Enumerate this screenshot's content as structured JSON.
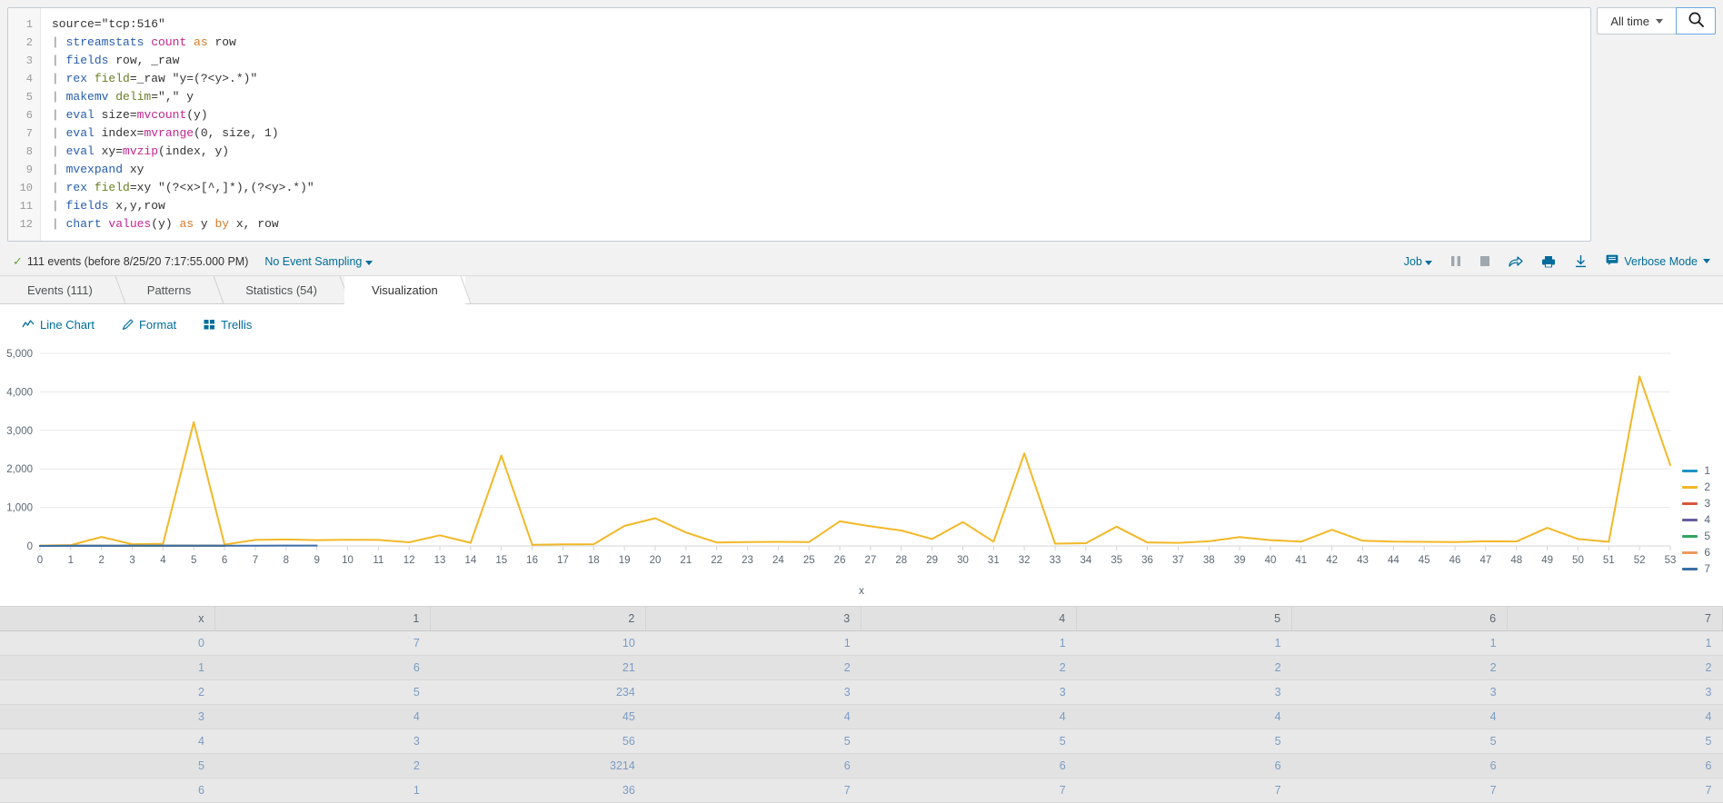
{
  "search": {
    "lines": [
      {
        "n": "1",
        "tokens": [
          {
            "t": "plain",
            "v": "source=\"tcp:516\""
          }
        ]
      },
      {
        "n": "2",
        "tokens": [
          {
            "t": "pipe",
            "v": "| "
          },
          {
            "t": "cmd",
            "v": "streamstats "
          },
          {
            "t": "kw",
            "v": "count "
          },
          {
            "t": "as",
            "v": "as "
          },
          {
            "t": "plain",
            "v": "row"
          }
        ]
      },
      {
        "n": "3",
        "tokens": [
          {
            "t": "pipe",
            "v": "| "
          },
          {
            "t": "cmd",
            "v": "fields "
          },
          {
            "t": "plain",
            "v": "row, _raw"
          }
        ]
      },
      {
        "n": "4",
        "tokens": [
          {
            "t": "pipe",
            "v": "| "
          },
          {
            "t": "cmd",
            "v": "rex "
          },
          {
            "t": "arg",
            "v": "field"
          },
          {
            "t": "plain",
            "v": "=_raw \"y=(?<y>.*)\""
          }
        ]
      },
      {
        "n": "5",
        "tokens": [
          {
            "t": "pipe",
            "v": "| "
          },
          {
            "t": "cmd",
            "v": "makemv "
          },
          {
            "t": "arg",
            "v": "delim"
          },
          {
            "t": "plain",
            "v": "=\",\" y"
          }
        ]
      },
      {
        "n": "6",
        "tokens": [
          {
            "t": "pipe",
            "v": "| "
          },
          {
            "t": "cmd",
            "v": "eval "
          },
          {
            "t": "plain",
            "v": "size="
          },
          {
            "t": "kw",
            "v": "mvcount"
          },
          {
            "t": "plain",
            "v": "(y)"
          }
        ]
      },
      {
        "n": "7",
        "tokens": [
          {
            "t": "pipe",
            "v": "| "
          },
          {
            "t": "cmd",
            "v": "eval "
          },
          {
            "t": "plain",
            "v": "index="
          },
          {
            "t": "kw",
            "v": "mvrange"
          },
          {
            "t": "plain",
            "v": "(0, size, 1)"
          }
        ]
      },
      {
        "n": "8",
        "tokens": [
          {
            "t": "pipe",
            "v": "| "
          },
          {
            "t": "cmd",
            "v": "eval "
          },
          {
            "t": "plain",
            "v": "xy="
          },
          {
            "t": "kw",
            "v": "mvzip"
          },
          {
            "t": "plain",
            "v": "(index, y)"
          }
        ]
      },
      {
        "n": "9",
        "tokens": [
          {
            "t": "pipe",
            "v": "| "
          },
          {
            "t": "cmd",
            "v": "mvexpand "
          },
          {
            "t": "plain",
            "v": "xy"
          }
        ]
      },
      {
        "n": "10",
        "tokens": [
          {
            "t": "pipe",
            "v": "| "
          },
          {
            "t": "cmd",
            "v": "rex "
          },
          {
            "t": "arg",
            "v": "field"
          },
          {
            "t": "plain",
            "v": "=xy \"(?<x>[^,]*),(?<y>.*)\""
          }
        ]
      },
      {
        "n": "11",
        "tokens": [
          {
            "t": "pipe",
            "v": "| "
          },
          {
            "t": "cmd",
            "v": "fields "
          },
          {
            "t": "plain",
            "v": "x,y,row"
          }
        ]
      },
      {
        "n": "12",
        "tokens": [
          {
            "t": "pipe",
            "v": "| "
          },
          {
            "t": "cmd",
            "v": "chart "
          },
          {
            "t": "kw",
            "v": "values"
          },
          {
            "t": "plain",
            "v": "(y) "
          },
          {
            "t": "as",
            "v": "as "
          },
          {
            "t": "plain",
            "v": "y "
          },
          {
            "t": "as",
            "v": "by "
          },
          {
            "t": "plain",
            "v": "x, row"
          }
        ]
      }
    ],
    "time_range_label": "All time",
    "search_icon": "search-icon"
  },
  "status": {
    "check_glyph": "✓",
    "event_count_text": "111 events (before 8/25/20 7:17:55.000 PM)",
    "event_sampling_label": "No Event Sampling",
    "job_label": "Job",
    "mode_label": "Verbose Mode",
    "icons": [
      "pause-icon",
      "stop-icon",
      "share-icon",
      "print-icon",
      "export-icon"
    ]
  },
  "tabs": [
    {
      "label": "Events (111)",
      "active": false
    },
    {
      "label": "Patterns",
      "active": false
    },
    {
      "label": "Statistics (54)",
      "active": false
    },
    {
      "label": "Visualization",
      "active": true
    }
  ],
  "viz_toolbar": [
    {
      "label": "Line Chart",
      "icon": "line-chart-icon"
    },
    {
      "label": "Format",
      "icon": "pencil-icon"
    },
    {
      "label": "Trellis",
      "icon": "grid-icon"
    }
  ],
  "chart_data": {
    "type": "line",
    "title": "",
    "xlabel": "x",
    "ylabel": "",
    "ylim": [
      0,
      5000
    ],
    "xlim": [
      0,
      53
    ],
    "grid": true,
    "legend_position": "right",
    "ytick_labels": [
      "0",
      "1,000",
      "2,000",
      "3,000",
      "4,000",
      "5,000"
    ],
    "ytick_values": [
      0,
      1000,
      2000,
      3000,
      4000,
      5000
    ],
    "x": [
      0,
      1,
      2,
      3,
      4,
      5,
      6,
      7,
      8,
      9,
      10,
      11,
      12,
      13,
      14,
      15,
      16,
      17,
      18,
      19,
      20,
      21,
      22,
      23,
      24,
      25,
      26,
      27,
      28,
      29,
      30,
      31,
      32,
      33,
      34,
      35,
      36,
      37,
      38,
      39,
      40,
      41,
      42,
      43,
      44,
      45,
      46,
      47,
      48,
      49,
      50,
      51,
      52,
      53
    ],
    "xtick_labels": [
      "0",
      "1",
      "2",
      "3",
      "4",
      "5",
      "6",
      "7",
      "8",
      "9",
      "10",
      "11",
      "12",
      "13",
      "14",
      "15",
      "16",
      "17",
      "18",
      "19",
      "20",
      "21",
      "22",
      "23",
      "24",
      "25",
      "26",
      "27",
      "28",
      "29",
      "30",
      "31",
      "32",
      "33",
      "34",
      "35",
      "36",
      "37",
      "38",
      "39",
      "40",
      "41",
      "42",
      "43",
      "44",
      "45",
      "46",
      "47",
      "48",
      "49",
      "50",
      "51",
      "52",
      "53"
    ],
    "series": [
      {
        "name": "1",
        "color": "#1e93c6",
        "values": [
          7,
          6,
          5,
          4,
          3,
          2,
          1,
          null,
          null,
          null,
          null,
          null,
          null,
          null,
          null,
          null,
          null,
          null,
          null,
          null,
          null,
          null,
          null,
          null,
          null,
          null,
          null,
          null,
          null,
          null,
          null,
          null,
          null,
          null,
          null,
          null,
          null,
          null,
          null,
          null,
          null,
          null,
          null,
          null,
          null,
          null,
          null,
          null,
          null,
          null,
          null,
          null,
          null,
          null
        ]
      },
      {
        "name": "2",
        "color": "#f2b827",
        "values": [
          10,
          21,
          234,
          45,
          56,
          3214,
          36,
          156,
          168,
          150,
          160,
          155,
          95,
          275,
          80,
          2350,
          30,
          40,
          45,
          520,
          720,
          350,
          90,
          100,
          105,
          100,
          640,
          510,
          400,
          180,
          620,
          110,
          2400,
          60,
          70,
          500,
          90,
          80,
          120,
          230,
          150,
          110,
          420,
          135,
          110,
          105,
          100,
          120,
          115,
          470,
          180,
          105,
          4400,
          2100
        ]
      },
      {
        "name": "3",
        "color": "#d6563c",
        "values": [
          1,
          2,
          3,
          4,
          5,
          6,
          7,
          null,
          null,
          null,
          null,
          null,
          null,
          null,
          null,
          null,
          null,
          null,
          null,
          null,
          null,
          null,
          null,
          null,
          null,
          null,
          null,
          null,
          null,
          null,
          null,
          null,
          null,
          null,
          null,
          null,
          null,
          null,
          null,
          null,
          null,
          null,
          null,
          null,
          null,
          null,
          null,
          null,
          null,
          null,
          null,
          null,
          null,
          null
        ]
      },
      {
        "name": "4",
        "color": "#6a5c9e",
        "values": [
          1,
          2,
          3,
          4,
          5,
          6,
          7,
          null,
          null,
          null,
          null,
          null,
          null,
          null,
          null,
          null,
          null,
          null,
          null,
          null,
          null,
          null,
          null,
          null,
          null,
          null,
          null,
          null,
          null,
          null,
          null,
          null,
          null,
          null,
          null,
          null,
          null,
          null,
          null,
          null,
          null,
          null,
          null,
          null,
          null,
          null,
          null,
          null,
          null,
          null,
          null,
          null,
          null,
          null
        ]
      },
      {
        "name": "5",
        "color": "#31a35f",
        "values": [
          1,
          2,
          3,
          4,
          5,
          6,
          7,
          null,
          null,
          null,
          null,
          null,
          null,
          null,
          null,
          null,
          null,
          null,
          null,
          null,
          null,
          null,
          null,
          null,
          null,
          null,
          null,
          null,
          null,
          null,
          null,
          null,
          null,
          null,
          null,
          null,
          null,
          null,
          null,
          null,
          null,
          null,
          null,
          null,
          null,
          null,
          null,
          null,
          null,
          null,
          null,
          null,
          null,
          null
        ]
      },
      {
        "name": "6",
        "color": "#ec9960",
        "values": [
          1,
          2,
          3,
          4,
          5,
          6,
          7,
          null,
          null,
          null,
          null,
          null,
          null,
          null,
          null,
          null,
          null,
          null,
          null,
          null,
          null,
          null,
          null,
          null,
          null,
          null,
          null,
          null,
          null,
          null,
          null,
          null,
          null,
          null,
          null,
          null,
          null,
          null,
          null,
          null,
          null,
          null,
          null,
          null,
          null,
          null,
          null,
          null,
          null,
          null,
          null,
          null,
          null,
          null
        ]
      },
      {
        "name": "7",
        "color": "#3b6ea5",
        "values": [
          1,
          2,
          3,
          4,
          5,
          6,
          7,
          8,
          9,
          10,
          null,
          null,
          null,
          null,
          null,
          null,
          null,
          null,
          null,
          null,
          null,
          null,
          null,
          null,
          null,
          null,
          null,
          null,
          null,
          null,
          null,
          null,
          null,
          null,
          null,
          null,
          null,
          null,
          null,
          null,
          null,
          null,
          null,
          null,
          null,
          null,
          null,
          null,
          null,
          null,
          null,
          null,
          null,
          null
        ]
      }
    ]
  },
  "results_table": {
    "headers": [
      "x",
      "1",
      "2",
      "3",
      "4",
      "5",
      "6",
      "7"
    ],
    "rows": [
      [
        "0",
        "7",
        "10",
        "1",
        "1",
        "1",
        "1",
        "1"
      ],
      [
        "1",
        "6",
        "21",
        "2",
        "2",
        "2",
        "2",
        "2"
      ],
      [
        "2",
        "5",
        "234",
        "3",
        "3",
        "3",
        "3",
        "3"
      ],
      [
        "3",
        "4",
        "45",
        "4",
        "4",
        "4",
        "4",
        "4"
      ],
      [
        "4",
        "3",
        "56",
        "5",
        "5",
        "5",
        "5",
        "5"
      ],
      [
        "5",
        "2",
        "3214",
        "6",
        "6",
        "6",
        "6",
        "6"
      ],
      [
        "6",
        "1",
        "36",
        "7",
        "7",
        "7",
        "7",
        "7"
      ]
    ]
  }
}
